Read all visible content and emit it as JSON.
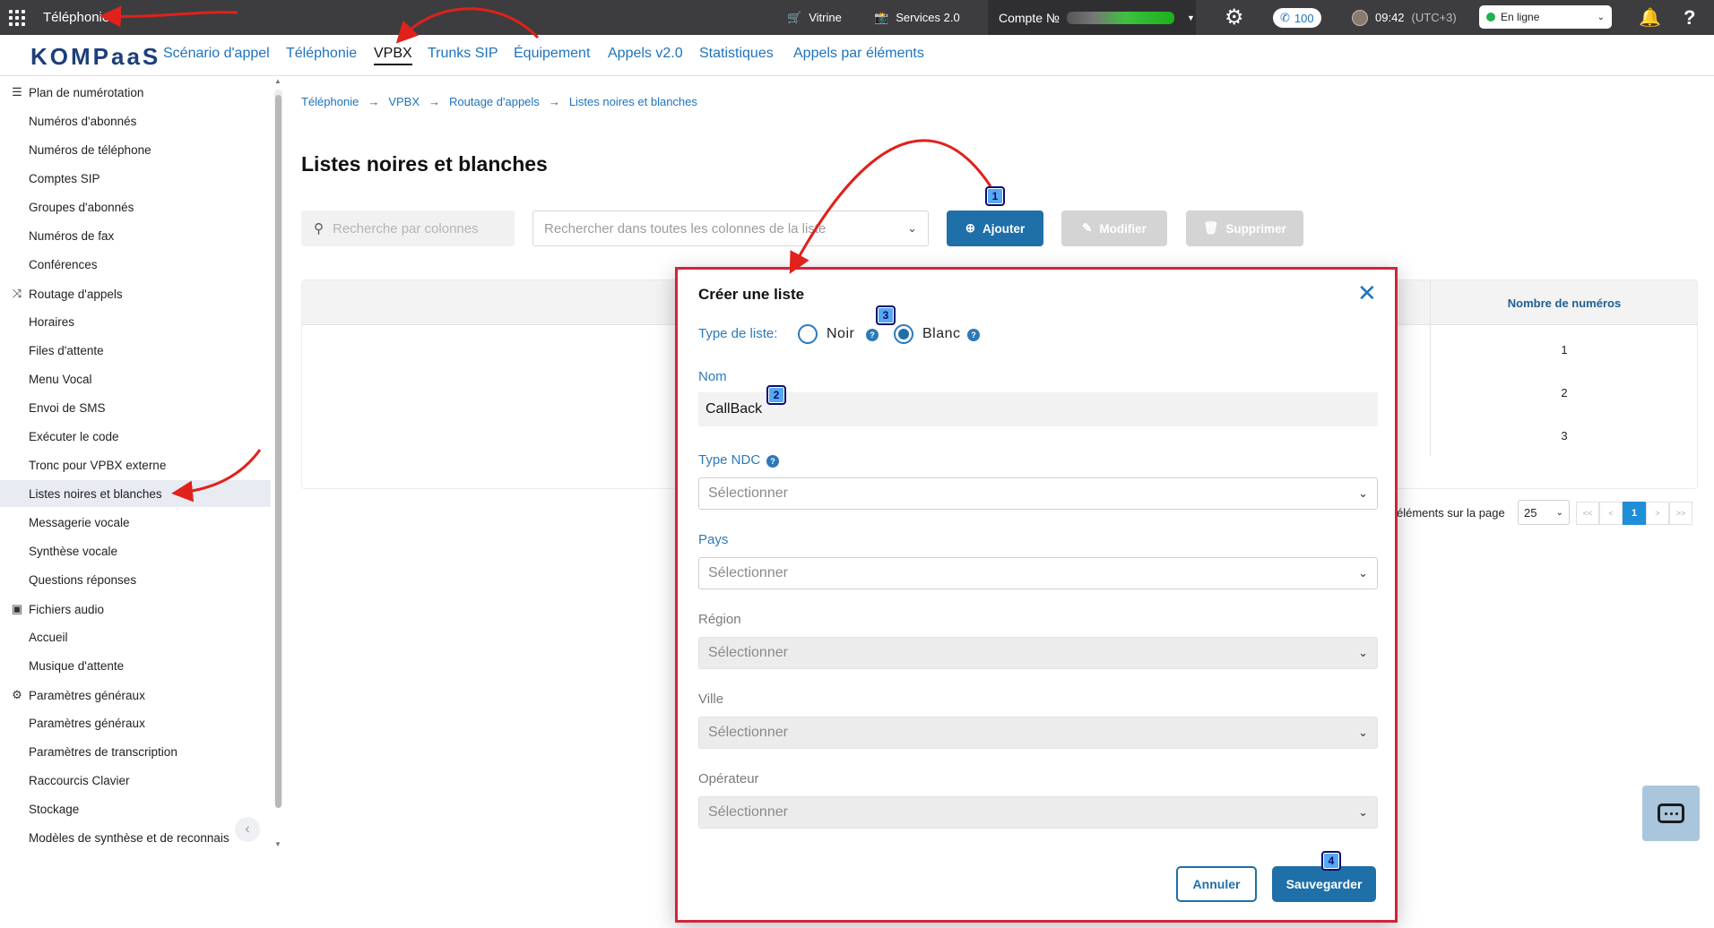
{
  "topbar": {
    "title": "Téléphonie",
    "vitrine": "Vitrine",
    "services": "Services 2.0",
    "account_label": "Compte №",
    "calls_count": "100",
    "time": "09:42",
    "timezone": "(UTC+3)",
    "status": "En ligne",
    "status_color": "#21b24b"
  },
  "nav": {
    "logo": "KOMPaaS",
    "tabs": [
      {
        "label": "Scénario d'appel"
      },
      {
        "label": "Téléphonie"
      },
      {
        "label": "VPBX",
        "active": true
      },
      {
        "label": "Trunks SIP"
      },
      {
        "label": "Équipement"
      },
      {
        "label": "Appels v2.0"
      },
      {
        "label": "Statistiques"
      },
      {
        "label": "Appels par éléments"
      }
    ]
  },
  "sidebar": {
    "items": [
      {
        "label": "Plan de numérotation",
        "type": "section",
        "icon": "list-icon"
      },
      {
        "label": "Numéros d'abonnés",
        "type": "item"
      },
      {
        "label": "Numéros de téléphone",
        "type": "item"
      },
      {
        "label": "Comptes SIP",
        "type": "item"
      },
      {
        "label": "Groupes d'abonnés",
        "type": "item"
      },
      {
        "label": "Numéros de fax",
        "type": "item"
      },
      {
        "label": "Conférences",
        "type": "item"
      },
      {
        "label": "Routage d'appels",
        "type": "section",
        "icon": "routing-icon"
      },
      {
        "label": "Horaires",
        "type": "item"
      },
      {
        "label": "Files d'attente",
        "type": "item"
      },
      {
        "label": "Menu Vocal",
        "type": "item"
      },
      {
        "label": "Envoi de SMS",
        "type": "item"
      },
      {
        "label": "Exécuter le code",
        "type": "item"
      },
      {
        "label": "Tronc pour VPBX externe",
        "type": "item"
      },
      {
        "label": "Listes noires et blanches",
        "type": "item",
        "selected": true
      },
      {
        "label": "Messagerie vocale",
        "type": "item"
      },
      {
        "label": "Synthèse vocale",
        "type": "item"
      },
      {
        "label": "Questions réponses",
        "type": "item"
      },
      {
        "label": "Fichiers audio",
        "type": "section",
        "icon": "audio-files-icon"
      },
      {
        "label": "Accueil",
        "type": "item"
      },
      {
        "label": "Musique d'attente",
        "type": "item"
      },
      {
        "label": "Paramètres généraux",
        "type": "section",
        "icon": "gear-icon"
      },
      {
        "label": "Paramètres généraux",
        "type": "item"
      },
      {
        "label": "Paramètres de transcription",
        "type": "item"
      },
      {
        "label": "Raccourcis Clavier",
        "type": "item"
      },
      {
        "label": "Stockage",
        "type": "item"
      },
      {
        "label": "Modèles de synthèse et de reconnais",
        "type": "item"
      }
    ]
  },
  "breadcrumb": [
    "Téléphonie",
    "VPBX",
    "Routage d'appels",
    "Listes noires et blanches"
  ],
  "page": {
    "title": "Listes noires et blanches",
    "search_columns_placeholder": "Recherche par colonnes",
    "search_all_placeholder": "Rechercher dans toutes les colonnes de la liste",
    "add_button": "Ajouter",
    "edit_button": "Modifier",
    "delete_button": "Supprimer"
  },
  "table": {
    "column_header": "Nombre de numéros",
    "rows": [
      "1",
      "2",
      "3"
    ]
  },
  "pagination": {
    "per_page_label": "éléments sur la page",
    "per_page_value": "25",
    "first": "<<",
    "prev": "<",
    "current": "1",
    "next": ">",
    "last": ">>"
  },
  "modal": {
    "title": "Créer une liste",
    "type_label": "Type de liste:",
    "option_black": "Noir",
    "option_white": "Blanc",
    "selected_option": "Blanc",
    "name_label": "Nom",
    "name_value": "CallBack",
    "ndc_label": "Type NDC",
    "ndc_value": "Sélectionner",
    "country_label": "Pays",
    "country_value": "Sélectionner",
    "region_label": "Région",
    "region_value": "Sélectionner",
    "city_label": "Ville",
    "city_value": "Sélectionner",
    "operator_label": "Opérateur",
    "operator_value": "Sélectionner",
    "cancel_button": "Annuler",
    "save_button": "Sauvegarder"
  },
  "annotations": {
    "step1": "1",
    "step2": "2",
    "step3": "3",
    "step4": "4",
    "arrow_color": "#e0211c"
  },
  "colors": {
    "topbar": "#3d3d3f",
    "accent": "#1f6fa8",
    "link": "#1e73be",
    "modal_border": "#d0253a"
  }
}
